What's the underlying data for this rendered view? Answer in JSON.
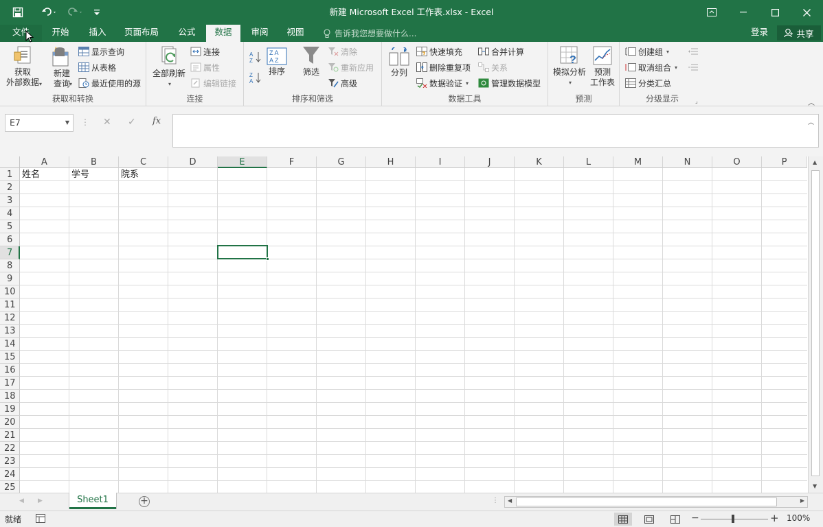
{
  "titlebar": {
    "document_title": "新建 Microsoft Excel 工作表.xlsx - Excel",
    "qat": [
      "save-icon",
      "undo-icon",
      "redo-icon",
      "customize-qat-icon"
    ],
    "controls": [
      "ribbon-display-options-icon",
      "minimize-icon",
      "maximize-icon",
      "close-icon"
    ]
  },
  "tabs": {
    "file": "文件",
    "home": "开始",
    "insert": "插入",
    "page_layout": "页面布局",
    "formulas": "公式",
    "data": "数据",
    "review": "审阅",
    "view": "视图",
    "tell_me": "告诉我您想要做什么...",
    "login": "登录",
    "share": "共享"
  },
  "ribbon": {
    "get_transform": {
      "label": "获取和转换",
      "get_external": "获取\n外部数据",
      "new_query": "新建\n查询",
      "show_queries": "显示查询",
      "from_table": "从表格",
      "recent_sources": "最近使用的源"
    },
    "connections": {
      "label": "连接",
      "refresh_all": "全部刷新",
      "connections": "连接",
      "properties": "属性",
      "edit_links": "编辑链接"
    },
    "sort_filter": {
      "label": "排序和筛选",
      "sort": "排序",
      "filter": "筛选",
      "clear": "清除",
      "reapply": "重新应用",
      "advanced": "高级"
    },
    "data_tools": {
      "label": "数据工具",
      "text_to_columns": "分列",
      "flash_fill": "快速填充",
      "remove_duplicates": "删除重复项",
      "data_validation": "数据验证",
      "consolidate": "合并计算",
      "relationships": "关系",
      "manage_data_model": "管理数据模型"
    },
    "forecast": {
      "label": "预测",
      "what_if": "模拟分析",
      "forecast_sheet": "预测\n工作表"
    },
    "outline": {
      "label": "分级显示",
      "group": "创建组",
      "ungroup": "取消组合",
      "subtotal": "分类汇总"
    }
  },
  "formula_bar": {
    "name_box": "E7",
    "fx": "fx",
    "content": ""
  },
  "grid": {
    "columns": [
      "A",
      "B",
      "C",
      "D",
      "E",
      "F",
      "G",
      "H",
      "I",
      "J",
      "K",
      "L",
      "M",
      "N",
      "O",
      "P"
    ],
    "rows": [
      "1",
      "2",
      "3",
      "4",
      "5",
      "6",
      "7",
      "8",
      "9",
      "10",
      "11",
      "12",
      "13",
      "14",
      "15",
      "16",
      "17",
      "18",
      "19",
      "20",
      "21",
      "22",
      "23",
      "24",
      "25"
    ],
    "selected_cell": "E7",
    "cells": {
      "A1": "姓名",
      "B1": "学号",
      "C1": "院系"
    }
  },
  "sheets": {
    "tabs": [
      "Sheet1"
    ],
    "active": "Sheet1"
  },
  "status": {
    "ready": "就绪",
    "zoom": "100%"
  },
  "colors": {
    "accent": "#217346",
    "ribbon_bg": "#f3f3f3",
    "gridline": "#dadada"
  }
}
